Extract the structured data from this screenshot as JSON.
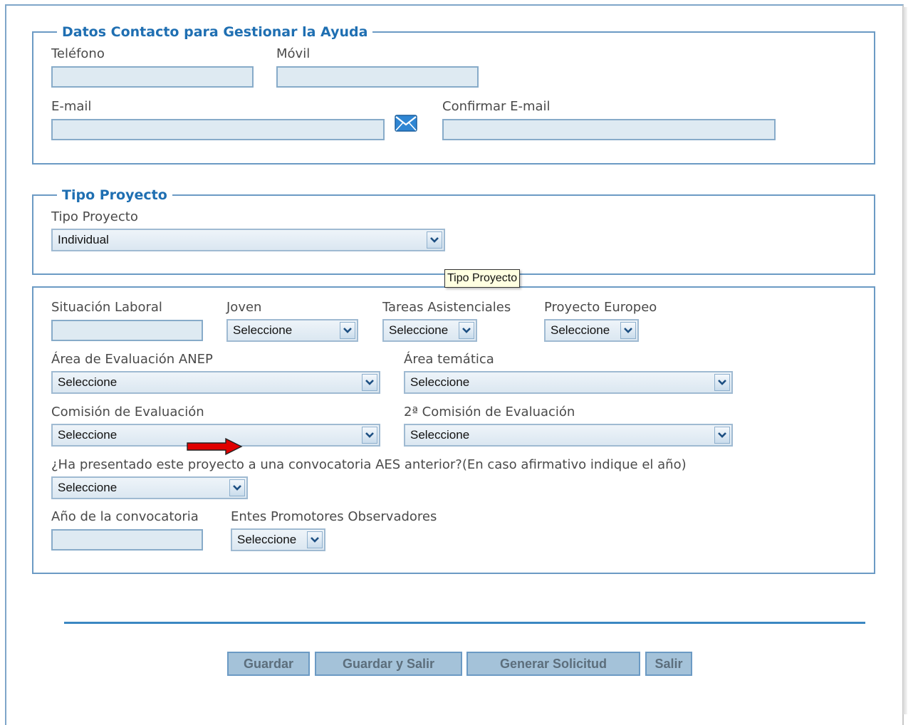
{
  "contact": {
    "legend": "Datos Contacto para Gestionar la Ayuda",
    "telefono_label": "Teléfono",
    "movil_label": "Móvil",
    "email_label": "E-mail",
    "confirmar_email_label": "Confirmar E-mail",
    "telefono_value": "",
    "movil_value": "",
    "email_value": "",
    "confirmar_email_value": ""
  },
  "tipo": {
    "legend": "Tipo Proyecto",
    "label": "Tipo Proyecto",
    "value": "Individual",
    "tooltip": "Tipo Proyecto"
  },
  "details": {
    "situacion_label": "Situación Laboral",
    "situacion_value": "",
    "joven_label": "Joven",
    "joven_value": "Seleccione",
    "tareas_label": "Tareas Asistenciales",
    "tareas_value": "Seleccione",
    "europeo_label": "Proyecto Europeo",
    "europeo_value": "Seleccione",
    "anep_label": "Área de Evaluación ANEP",
    "anep_value": "Seleccione",
    "tematica_label": "Área temática",
    "tematica_value": "Seleccione",
    "comision_label": "Comisión de Evaluación",
    "comision_value": "Seleccione",
    "comision2_label": "2ª Comisión de Evaluación",
    "comision2_value": "Seleccione",
    "aes_question": "¿Ha presentado este proyecto a una convocatoria AES anterior?(En caso afirmativo indique el año)",
    "aes_value": "Seleccione",
    "anio_label": "Año de la convocatoria",
    "anio_value": "",
    "entes_label": "Entes Promotores Observadores",
    "entes_value": "Seleccione"
  },
  "buttons": {
    "guardar": "Guardar",
    "guardar_salir": "Guardar y Salir",
    "generar": "Generar Solicitud",
    "salir": "Salir"
  },
  "colors": {
    "accent": "#1f6fb2",
    "border": "#6b9ac4",
    "input_bg": "#deeaf2",
    "arrow": "#e00000"
  },
  "icons": {
    "email": "envelope-icon",
    "dropdown": "chevron-down-icon",
    "pointer": "red-arrow-icon"
  }
}
